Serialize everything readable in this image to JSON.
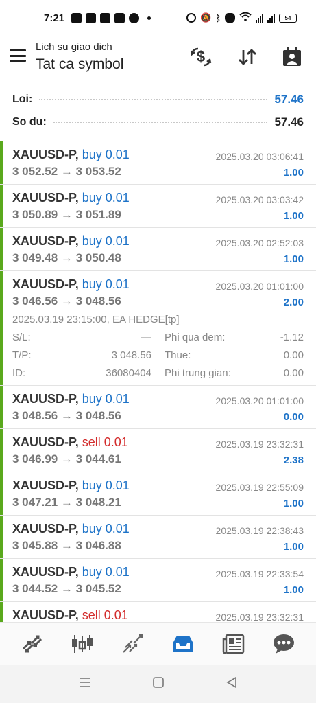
{
  "status_bar": {
    "time": "7:21",
    "battery": "54"
  },
  "header": {
    "subtitle": "Lich su giao dich",
    "title": "Tat ca symbol"
  },
  "summary": {
    "profit_label": "Loi:",
    "profit_value": "57.46",
    "balance_label": "So du:",
    "balance_value": "57.46"
  },
  "trades": [
    {
      "symbol": "XAUUSD-P,",
      "direction": "buy",
      "dir_text": "buy 0.01",
      "prices": "3 052.52 → 3 053.52",
      "time": "2025.03.20 03:06:41",
      "profit": "1.00"
    },
    {
      "symbol": "XAUUSD-P,",
      "direction": "buy",
      "dir_text": "buy 0.01",
      "prices": "3 050.89 → 3 051.89",
      "time": "2025.03.20 03:03:42",
      "profit": "1.00"
    },
    {
      "symbol": "XAUUSD-P,",
      "direction": "buy",
      "dir_text": "buy 0.01",
      "prices": "3 049.48 → 3 050.48",
      "time": "2025.03.20 02:52:03",
      "profit": "1.00"
    },
    {
      "symbol": "XAUUSD-P,",
      "direction": "buy",
      "dir_text": "buy 0.01",
      "prices": "3 046.56 → 3 048.56",
      "time": "2025.03.20 01:01:00",
      "profit": "2.00"
    },
    {
      "symbol": "XAUUSD-P,",
      "direction": "buy",
      "dir_text": "buy 0.01",
      "prices": "3 048.56 → 3 048.56",
      "time": "2025.03.20 01:01:00",
      "profit": "0.00"
    },
    {
      "symbol": "XAUUSD-P,",
      "direction": "sell",
      "dir_text": "sell 0.01",
      "prices": "3 046.99 → 3 044.61",
      "time": "2025.03.19 23:32:31",
      "profit": "2.38"
    },
    {
      "symbol": "XAUUSD-P,",
      "direction": "buy",
      "dir_text": "buy 0.01",
      "prices": "3 047.21 → 3 048.21",
      "time": "2025.03.19 22:55:09",
      "profit": "1.00"
    },
    {
      "symbol": "XAUUSD-P,",
      "direction": "buy",
      "dir_text": "buy 0.01",
      "prices": "3 045.88 → 3 046.88",
      "time": "2025.03.19 22:38:43",
      "profit": "1.00"
    },
    {
      "symbol": "XAUUSD-P,",
      "direction": "buy",
      "dir_text": "buy 0.01",
      "prices": "3 044.52 → 3 045.52",
      "time": "2025.03.19 22:33:54",
      "profit": "1.00"
    },
    {
      "symbol": "XAUUSD-P,",
      "direction": "sell",
      "dir_text": "sell 0.01",
      "prices": "",
      "time": "2025.03.19 23:32:31",
      "profit": ""
    }
  ],
  "expanded": {
    "open_info": "2025.03.19 23:15:00, EA HEDGE[tp]",
    "sl_label": "S/L:",
    "sl_value": "—",
    "tp_label": "T/P:",
    "tp_value": "3 048.56",
    "id_label": "ID:",
    "id_value": "36080404",
    "swap_label": "Phi qua dem:",
    "swap_value": "-1.12",
    "tax_label": "Thue:",
    "tax_value": "0.00",
    "commission_label": "Phi trung gian:",
    "commission_value": "0.00"
  },
  "bottom_nav": [
    "quotes-icon",
    "chart-icon",
    "trade-icon",
    "history-icon",
    "news-icon",
    "chat-icon"
  ],
  "colors": {
    "accent": "#1e73c8",
    "sell": "#d32b2b",
    "bar": "#5aa91d"
  }
}
